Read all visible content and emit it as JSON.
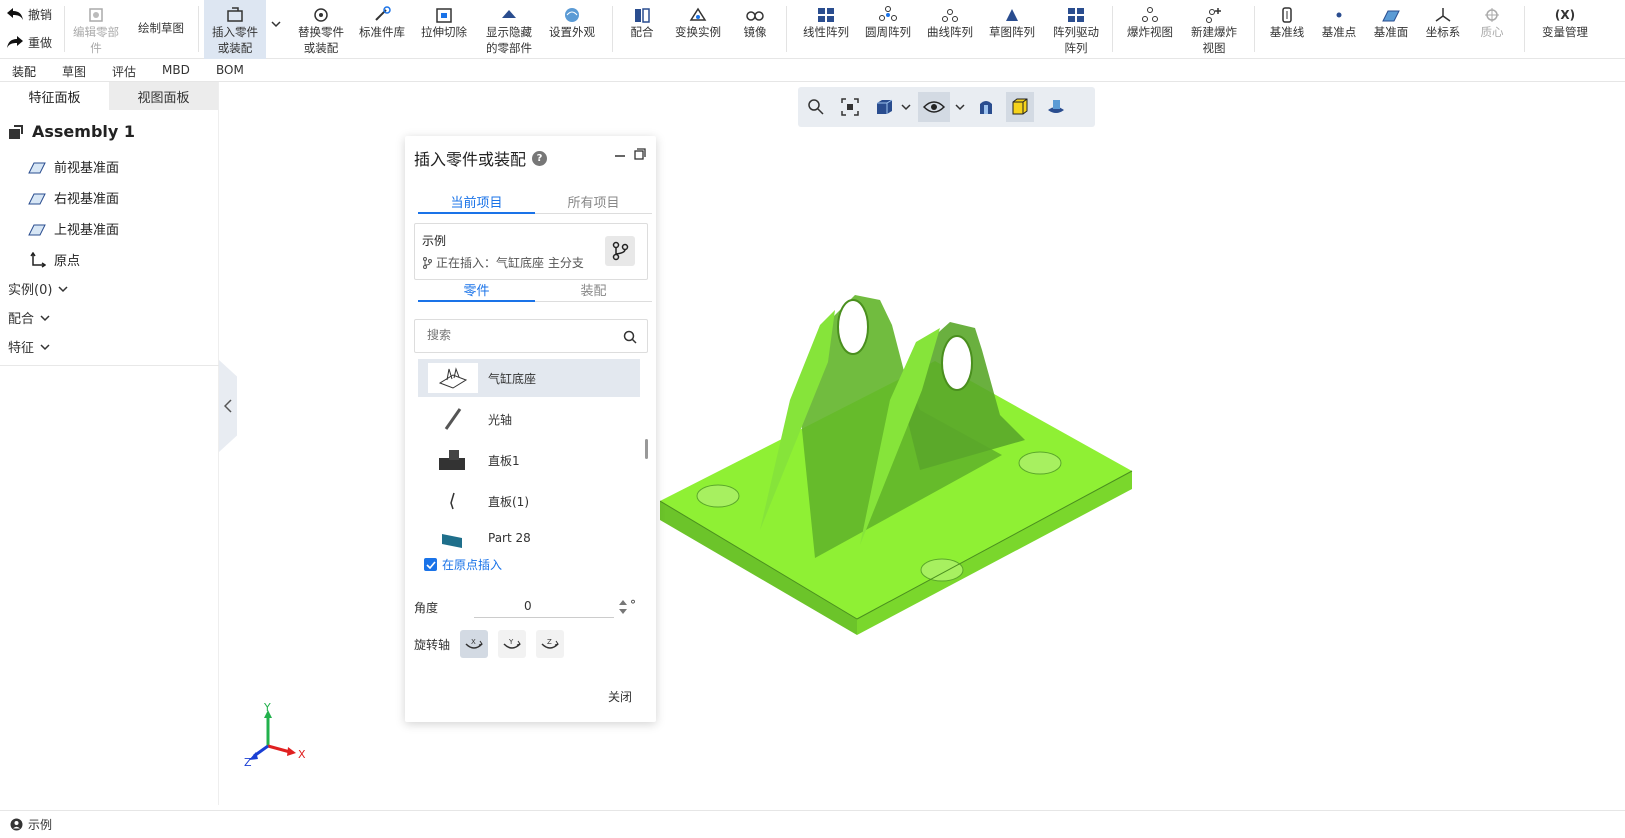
{
  "toolbar": {
    "undo": "撤销",
    "redo": "重做",
    "items": [
      {
        "label": "编辑零部\n件",
        "icon": "edit-part-icon"
      },
      {
        "label": "绘制草图",
        "icon": "sketch-icon"
      },
      {
        "label": "插入零件\n或装配",
        "icon": "insert-part-icon"
      },
      {
        "label": "替换零件\n或装配",
        "icon": "replace-part-icon"
      },
      {
        "label": "标准件库",
        "icon": "standard-parts-icon"
      },
      {
        "label": "拉伸切除",
        "icon": "extrude-cut-icon"
      },
      {
        "label": "显示隐藏\n的零部件",
        "icon": "show-hidden-icon"
      },
      {
        "label": "设置外观",
        "icon": "appearance-icon"
      },
      {
        "label": "配合",
        "icon": "mate-icon"
      },
      {
        "label": "变换实例",
        "icon": "transform-icon"
      },
      {
        "label": "镜像",
        "icon": "mirror-icon"
      },
      {
        "label": "线性阵列",
        "icon": "linear-pattern-icon"
      },
      {
        "label": "圆周阵列",
        "icon": "circular-pattern-icon"
      },
      {
        "label": "曲线阵列",
        "icon": "curve-pattern-icon"
      },
      {
        "label": "草图阵列",
        "icon": "sketch-pattern-icon"
      },
      {
        "label": "阵列驱动\n阵列",
        "icon": "pattern-driven-icon"
      },
      {
        "label": "爆炸视图",
        "icon": "explode-view-icon"
      },
      {
        "label": "新建爆炸\n视图",
        "icon": "new-explode-icon"
      },
      {
        "label": "基准线",
        "icon": "ref-line-icon"
      },
      {
        "label": "基准点",
        "icon": "ref-point-icon"
      },
      {
        "label": "基准面",
        "icon": "ref-plane-icon"
      },
      {
        "label": "坐标系",
        "icon": "coordinate-system-icon"
      },
      {
        "label": "质心",
        "icon": "center-of-mass-icon"
      },
      {
        "label": "变量管理",
        "icon": "variables-icon",
        "glyph": "(X)"
      }
    ]
  },
  "tabs": [
    "装配",
    "草图",
    "评估",
    "MBD",
    "BOM"
  ],
  "left_panel": {
    "tabs": [
      "特征面板",
      "视图面板"
    ],
    "assembly": "Assembly 1",
    "planes": [
      "前视基准面",
      "右视基准面",
      "上视基准面"
    ],
    "origin": "原点",
    "groups": [
      "实例(0)",
      "配合",
      "特征"
    ]
  },
  "insert_panel": {
    "title": "插入零件或装配",
    "scope_tabs": [
      "当前项目",
      "所有项目"
    ],
    "example_title": "示例",
    "example_sub": "正在插入：气缸底座 主分支",
    "type_tabs": [
      "零件",
      "装配"
    ],
    "search_placeholder": "搜索",
    "parts": [
      "气缸底座",
      "光轴",
      "直板1",
      "直板(1)",
      "Part 28"
    ],
    "insert_at_origin": "在原点插入",
    "angle_label": "角度",
    "angle_value": "0",
    "angle_unit": "°",
    "rotation_label": "旋转轴",
    "axes": [
      "X",
      "Y",
      "Z"
    ],
    "close": "关闭"
  },
  "triad": {
    "x": "X",
    "y": "Y",
    "z": "Z"
  },
  "status": {
    "user": "示例"
  },
  "colors": {
    "part_green": "#7ee32a",
    "accent": "#1a73e8"
  }
}
